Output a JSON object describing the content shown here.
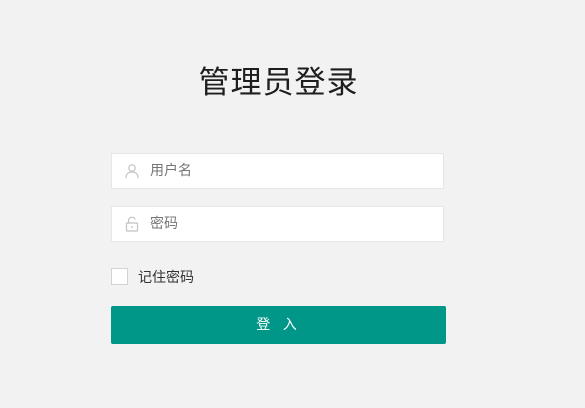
{
  "page": {
    "title": "管理员登录"
  },
  "form": {
    "username": {
      "icon": "user-icon",
      "placeholder": "用户名",
      "value": ""
    },
    "password": {
      "icon": "lock-icon",
      "placeholder": "密码",
      "value": ""
    },
    "remember": {
      "label": "记住密码",
      "checked": false
    },
    "submit_label": "登 入"
  },
  "colors": {
    "background": "#f2f2f2",
    "button": "#009688",
    "field_border": "#e6e6e6",
    "icon": "#c2c2c2"
  }
}
